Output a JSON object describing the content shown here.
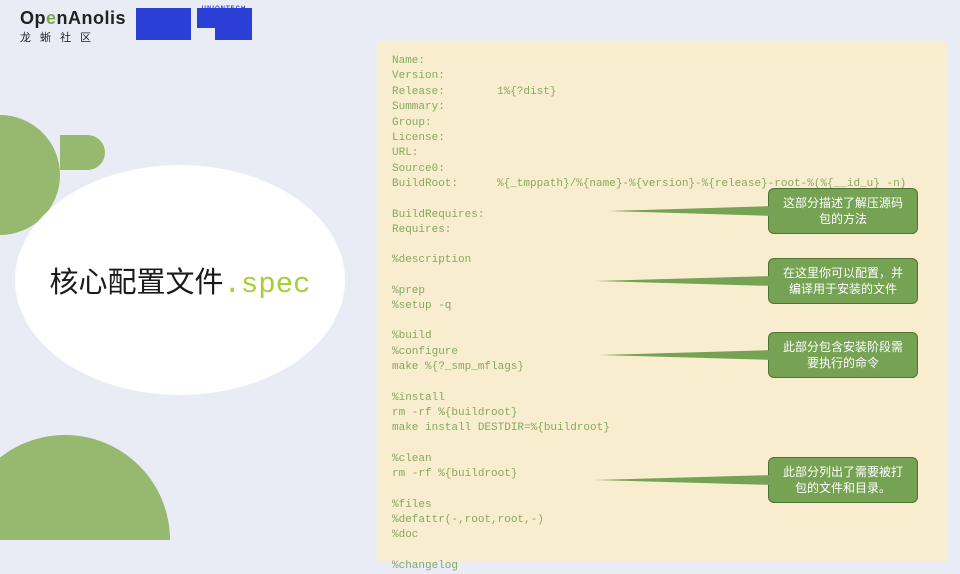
{
  "logo": {
    "brand_pre": "Op",
    "brand_e": "e",
    "brand_post": "nAnolis",
    "sub": "龙 蜥 社 区",
    "uniontech": "UNIONTECH"
  },
  "title": {
    "main": "核心配置文件",
    "dot": ".",
    "spec": "spec"
  },
  "spec": {
    "name_k": "Name:",
    "version_k": "Version:",
    "release_k": "Release:",
    "release_v": "1%{?dist}",
    "summary_k": "Summary:",
    "group_k": "Group:",
    "license_k": "License:",
    "url_k": "URL:",
    "source0_k": "Source0:",
    "buildroot_k": "BuildRoot:",
    "buildroot_v": "%{_tmppath}/%{name}-%{version}-%{release}-root-%(%{__id_u} -n)",
    "buildreq_k": "BuildRequires:",
    "req_k": "Requires:",
    "desc": "%description",
    "prep": "%prep",
    "setup": "%setup -q",
    "build": "%build",
    "configure": "%configure",
    "make": "make %{?_smp_mflags}",
    "install": "%install",
    "rm1": "rm -rf %{buildroot}",
    "makeinstall": "make install DESTDIR=%{buildroot}",
    "clean": "%clean",
    "rm2": "rm -rf %{buildroot}",
    "files": "%files",
    "defattr": "%defattr(-,root,root,-)",
    "doc": "%doc",
    "changelog": "%changelog"
  },
  "callouts": {
    "c1": "这部分描述了解压源码包的方法",
    "c2": "在这里你可以配置，并编译用于安装的文件",
    "c3": "此部分包含安装阶段需要执行的命令",
    "c4": "此部分列出了需要被打包的文件和目录。"
  }
}
